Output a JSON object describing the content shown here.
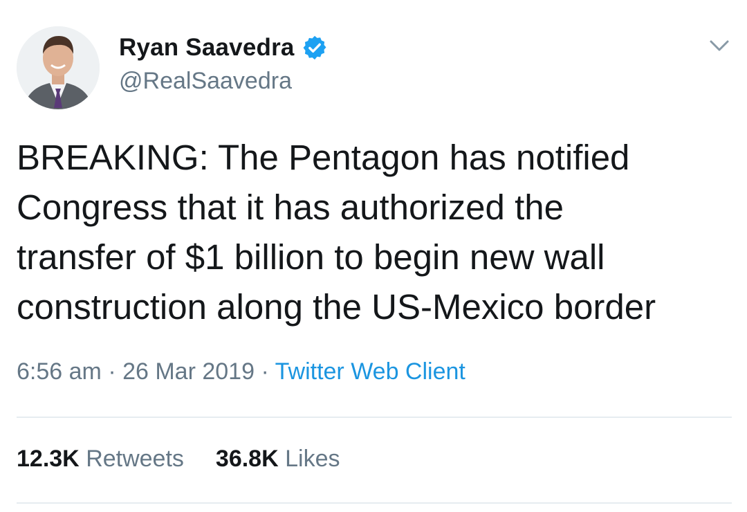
{
  "author": {
    "display_name": "Ryan Saavedra",
    "handle": "@RealSaavedra",
    "verified": true
  },
  "tweet": {
    "text": "BREAKING: The Pentagon has notified\nCongress that it has authorized the\ntransfer of $1 billion to begin new wall\nconstruction along the US-Mexico border",
    "time": "6:56 am",
    "date": "26 Mar 2019",
    "separator": "·",
    "source": "Twitter Web Client"
  },
  "stats": {
    "retweets_count": "12.3K",
    "retweets_label": "Retweets",
    "likes_count": "36.8K",
    "likes_label": "Likes"
  },
  "icons": {
    "verified": "verified-badge-icon",
    "menu": "chevron-down-icon"
  },
  "colors": {
    "text_primary": "#14171a",
    "text_secondary": "#657786",
    "link": "#1b95e0",
    "verified": "#1da1f2",
    "divider": "#e6ecf0"
  }
}
